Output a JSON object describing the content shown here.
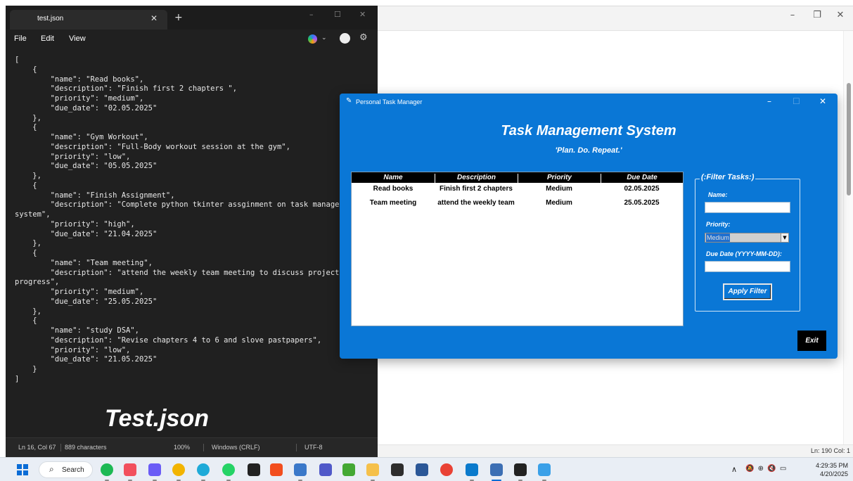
{
  "background_window": {
    "controls": [
      "–",
      "❐",
      "✕"
    ],
    "status_text": "Ln: 190   Col: 1"
  },
  "notepad": {
    "tab_title": "test.json",
    "tab_close": "✕",
    "new_tab": "+",
    "window_controls": [
      "–",
      "☐",
      "✕"
    ],
    "menu": [
      "File",
      "Edit",
      "View"
    ],
    "copilot_chevron": "⌄",
    "settings_glyph": "⚙",
    "code": "[\n    {\n        \"name\": \"Read books\",\n        \"description\": \"Finish first 2 chapters \",\n        \"priority\": \"medium\",\n        \"due_date\": \"02.05.2025\"\n    },\n    {\n        \"name\": \"Gym Workout\",\n        \"description\": \"Full-Body workout session at the gym\",\n        \"priority\": \"low\",\n        \"due_date\": \"05.05.2025\"\n    },\n    {\n        \"name\": \"Finish Assignment\",\n        \"description\": \"Complete python tkinter assginment on task managem\nsystem\",\n        \"priority\": \"high\",\n        \"due_date\": \"21.04.2025\"\n    },\n    {\n        \"name\": \"Team meeting\",\n        \"description\": \"attend the weekly team meeting to discuss project\nprogress\",\n        \"priority\": \"medium\",\n        \"due_date\": \"25.05.2025\"\n    },\n    {\n        \"name\": \"study DSA\",\n        \"description\": \"Revise chapters 4 to 6 and slove pastpapers\",\n        \"priority\": \"low\",\n        \"due_date\": \"21.05.2025\"\n    }\n]",
    "caption": "Test.json",
    "status": {
      "position": "Ln 16, Col 67",
      "characters": "889 characters",
      "zoom": "100%",
      "line_ending": "Windows (CRLF)",
      "encoding": "UTF-8"
    }
  },
  "tk_app": {
    "icon_glyph": "✎",
    "window_title": "Personal Task Manager",
    "window_controls": [
      "–",
      "☐",
      "✕"
    ],
    "heading": "Task Management System",
    "tagline": "'Plan. Do. Repeat.'",
    "table": {
      "columns": [
        "Name",
        "Description",
        "Priority",
        "Due Date"
      ],
      "rows": [
        {
          "name": "Read books",
          "description": "Finish first 2 chapters",
          "priority": "Medium",
          "due_date": "02.05.2025"
        },
        {
          "name": "Team meeting",
          "description": "attend the weekly team",
          "priority": "Medium",
          "due_date": "25.05.2025"
        }
      ]
    },
    "filter": {
      "legend": "(:Filter Tasks:)",
      "name_label": "Name:",
      "name_value": "",
      "priority_label": "Priority:",
      "priority_value": "Medium",
      "priority_arrow": "▼",
      "due_label": "Due Date (YYYY-MM-DD):",
      "due_value": "",
      "apply_label": "Apply Filter"
    },
    "exit_label": "Exit",
    "colors": {
      "window_bg": "#0a77d6",
      "table_header": "#000000",
      "exit_bg": "#000000"
    }
  },
  "taskbar": {
    "search_icon": "⌕",
    "search_label": "Search",
    "tray": {
      "chevron": "∧",
      "icons": "🔕  ⊕  🔇  ▭"
    },
    "time": "4:29:35 PM",
    "date": "4/20/2025",
    "apps": [
      {
        "name": "spotify",
        "color": "#1db954"
      },
      {
        "name": "photos",
        "color": "#f2505d"
      },
      {
        "name": "copilot",
        "color": "#6a5cf6"
      },
      {
        "name": "chrome",
        "color": "#f2b400"
      },
      {
        "name": "canva",
        "color": "#1eaad8"
      },
      {
        "name": "whatsapp",
        "color": "#25d366"
      },
      {
        "name": "notion",
        "color": "#222222"
      },
      {
        "name": "figma",
        "color": "#f24e1e"
      },
      {
        "name": "python",
        "color": "#3a78c9"
      },
      {
        "name": "teams",
        "color": "#5059c9"
      },
      {
        "name": "anaconda",
        "color": "#44a833"
      },
      {
        "name": "file-explorer",
        "color": "#f5c04a"
      },
      {
        "name": "terminal",
        "color": "#2d2d2d"
      },
      {
        "name": "word",
        "color": "#2b5797"
      },
      {
        "name": "chrome-profile",
        "color": "#e94235"
      },
      {
        "name": "vscode",
        "color": "#0a7acc"
      },
      {
        "name": "python-idle",
        "color": "#3c6fb4"
      },
      {
        "name": "notion-2",
        "color": "#222222"
      },
      {
        "name": "notepad",
        "color": "#3aa0e8"
      }
    ]
  }
}
